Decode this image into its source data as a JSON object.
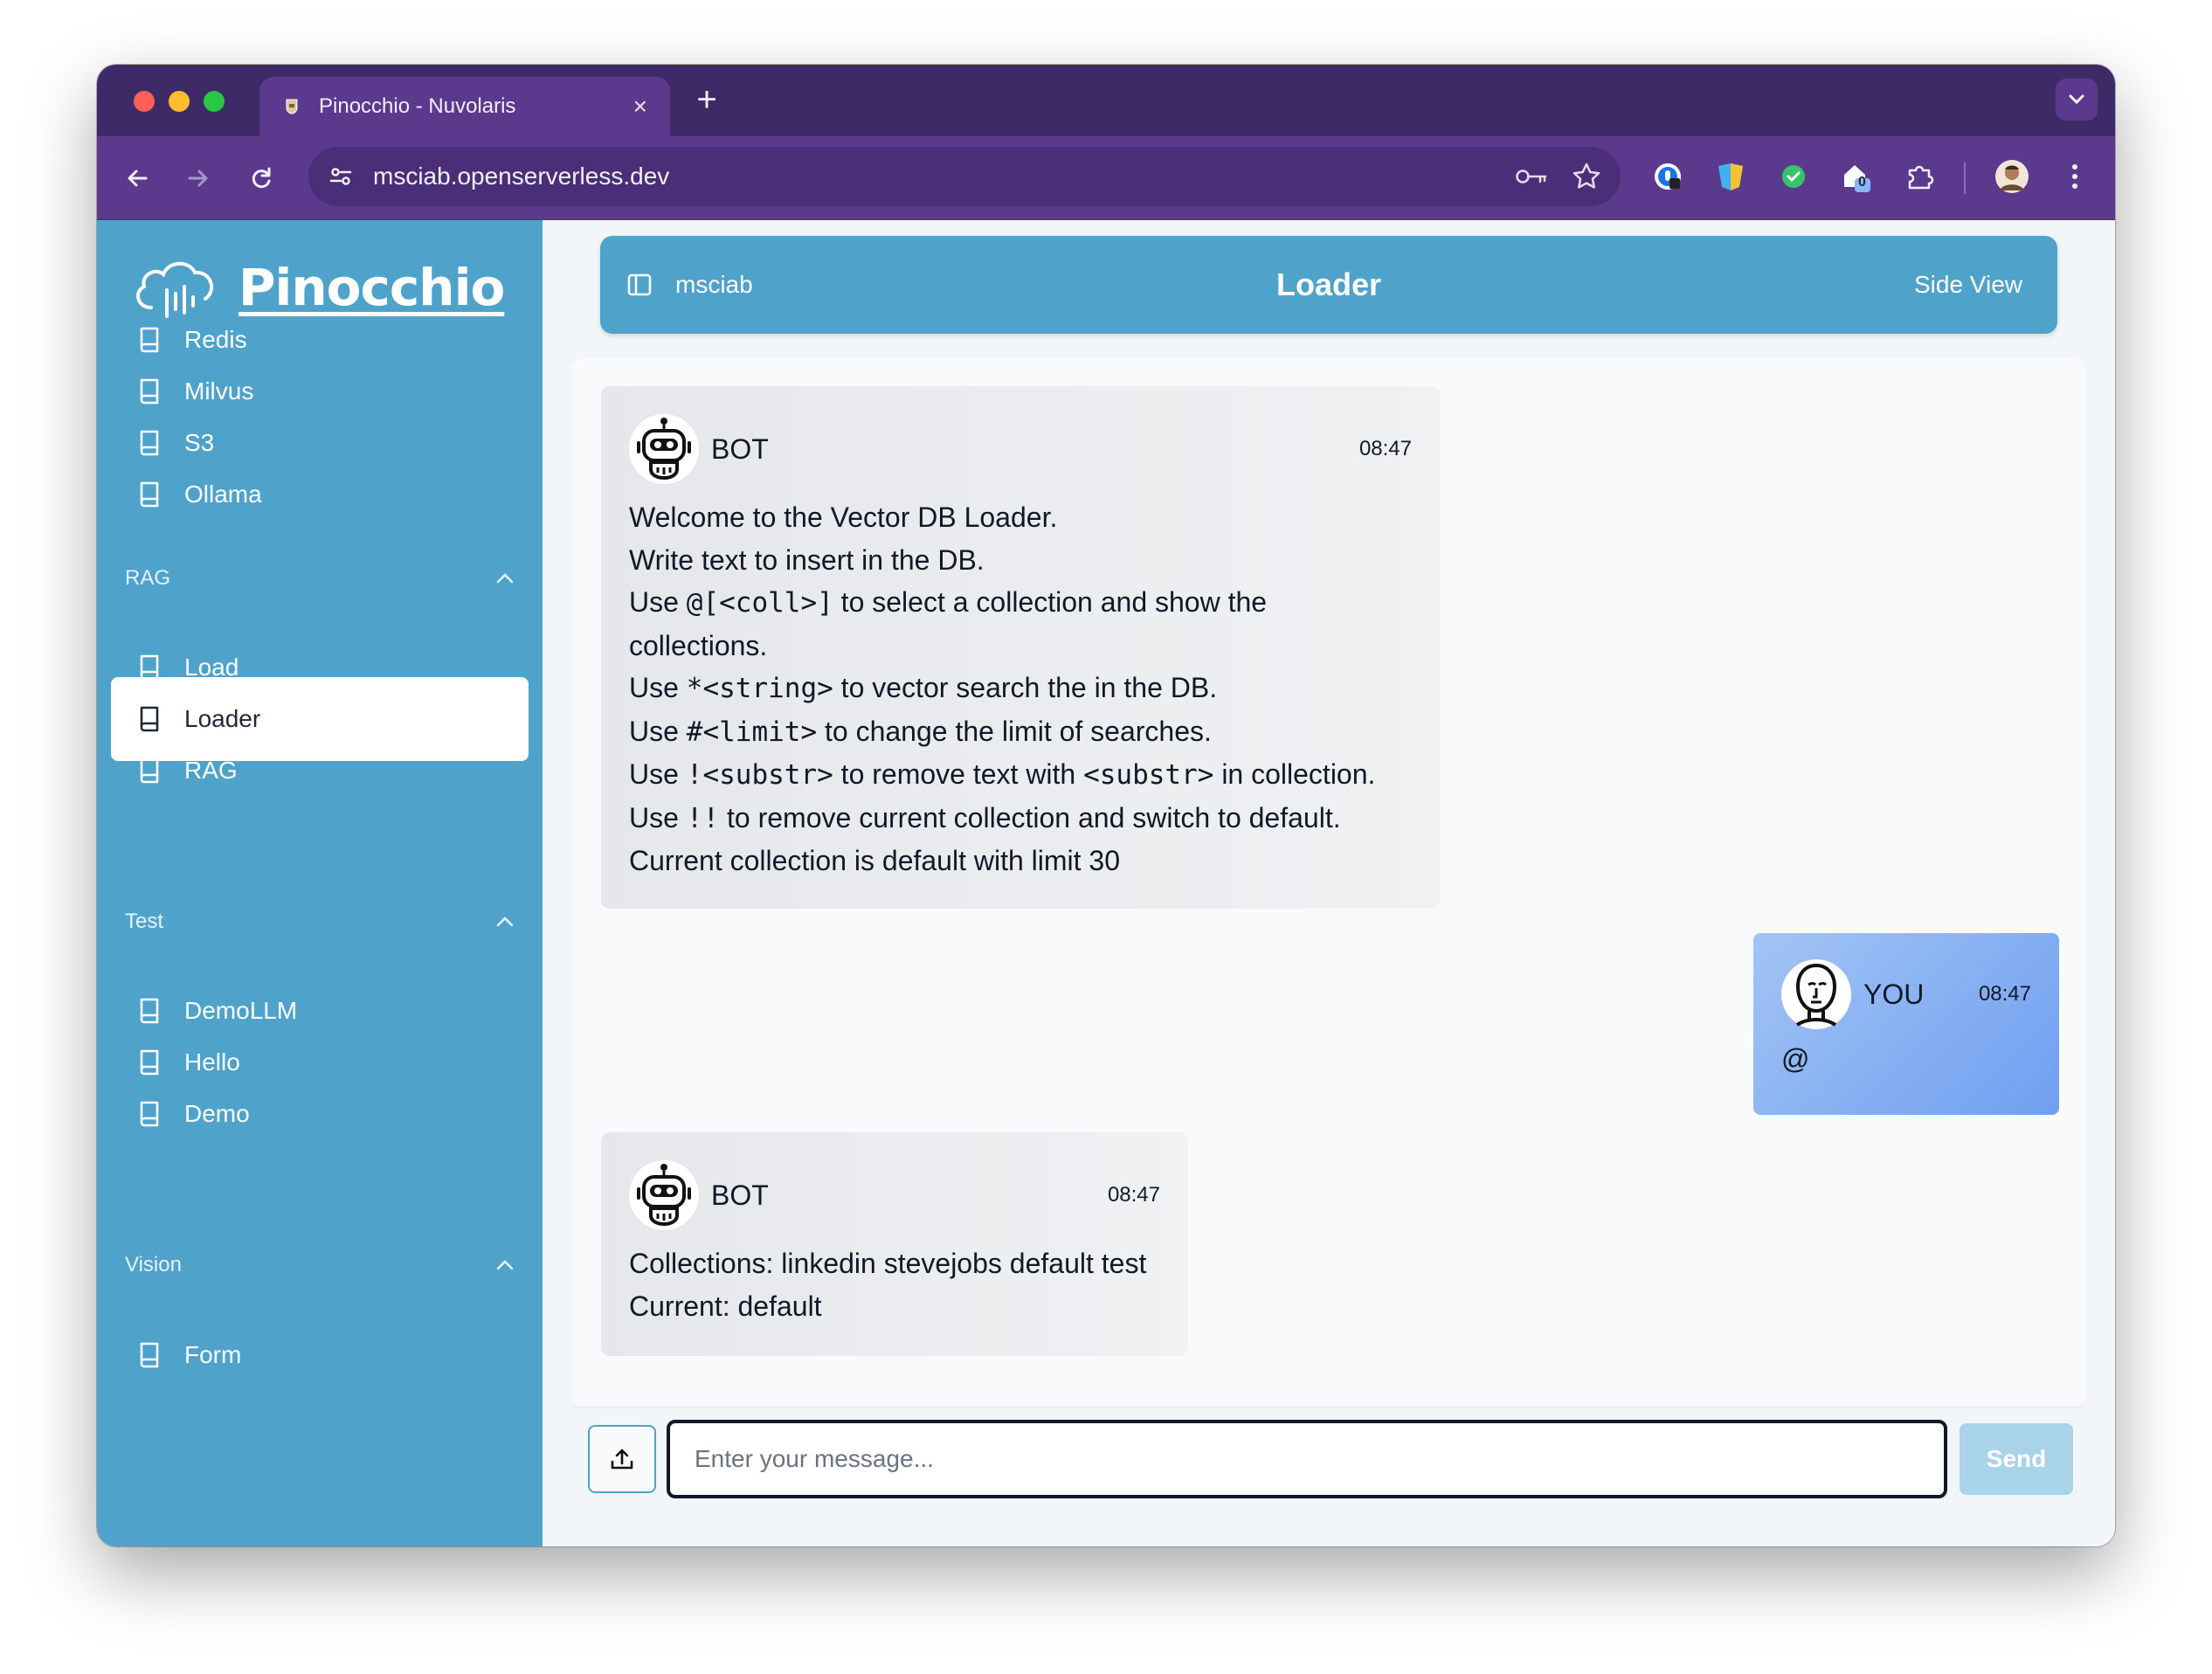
{
  "browser": {
    "tab_title": "Pinocchio - Nuvolaris",
    "url": "msciab.openserverless.dev",
    "extension_badge": "0"
  },
  "sidebar": {
    "logo_text": "Pinocchio",
    "top_items": [
      {
        "label": "Redis"
      },
      {
        "label": "Milvus"
      },
      {
        "label": "S3"
      },
      {
        "label": "Ollama"
      }
    ],
    "sections": [
      {
        "title": "RAG",
        "items": [
          {
            "label": "Load"
          },
          {
            "label": "Loader",
            "active": true
          },
          {
            "label": "RAG"
          }
        ]
      },
      {
        "title": "Test",
        "items": [
          {
            "label": "DemoLLM"
          },
          {
            "label": "Hello"
          },
          {
            "label": "Demo"
          }
        ]
      },
      {
        "title": "Vision",
        "items": [
          {
            "label": "Form"
          }
        ]
      }
    ]
  },
  "header": {
    "user": "msciab",
    "title": "Loader",
    "side_view": "Side View"
  },
  "messages": [
    {
      "sender": "BOT",
      "time": "08:47",
      "lines": [
        {
          "parts": [
            {
              "t": "Welcome to the Vector DB Loader."
            }
          ]
        },
        {
          "parts": [
            {
              "t": "Write text to insert in the DB."
            }
          ]
        },
        {
          "parts": [
            {
              "t": "Use "
            },
            {
              "t": "@[<coll>]",
              "code": true
            },
            {
              "t": " to select a collection and show the"
            }
          ]
        },
        {
          "parts": [
            {
              "t": "collections."
            }
          ]
        },
        {
          "parts": [
            {
              "t": "Use "
            },
            {
              "t": "*<string>",
              "code": true
            },
            {
              "t": " to vector search the in the DB."
            }
          ]
        },
        {
          "parts": [
            {
              "t": "Use "
            },
            {
              "t": "#<limit>",
              "code": true
            },
            {
              "t": " to change the limit of searches."
            }
          ]
        },
        {
          "parts": [
            {
              "t": "Use "
            },
            {
              "t": "!<substr>",
              "code": true
            },
            {
              "t": " to remove text with "
            },
            {
              "t": "<substr>",
              "code": true
            },
            {
              "t": " in collection."
            }
          ]
        },
        {
          "parts": [
            {
              "t": "Use "
            },
            {
              "t": "!!",
              "code": true
            },
            {
              "t": " to remove current collection and switch to default."
            }
          ]
        },
        {
          "parts": [
            {
              "t": "Current collection is default with limit 30"
            }
          ]
        }
      ]
    },
    {
      "sender": "YOU",
      "time": "08:47",
      "lines": [
        {
          "parts": [
            {
              "t": "@"
            }
          ]
        }
      ]
    },
    {
      "sender": "BOT",
      "time": "08:47",
      "lines": [
        {
          "parts": [
            {
              "t": "Collections: linkedin stevejobs default test"
            }
          ]
        },
        {
          "parts": [
            {
              "t": "Current: default"
            }
          ]
        }
      ]
    }
  ],
  "input": {
    "placeholder": "Enter your message...",
    "value": "",
    "send_label": "Send"
  }
}
